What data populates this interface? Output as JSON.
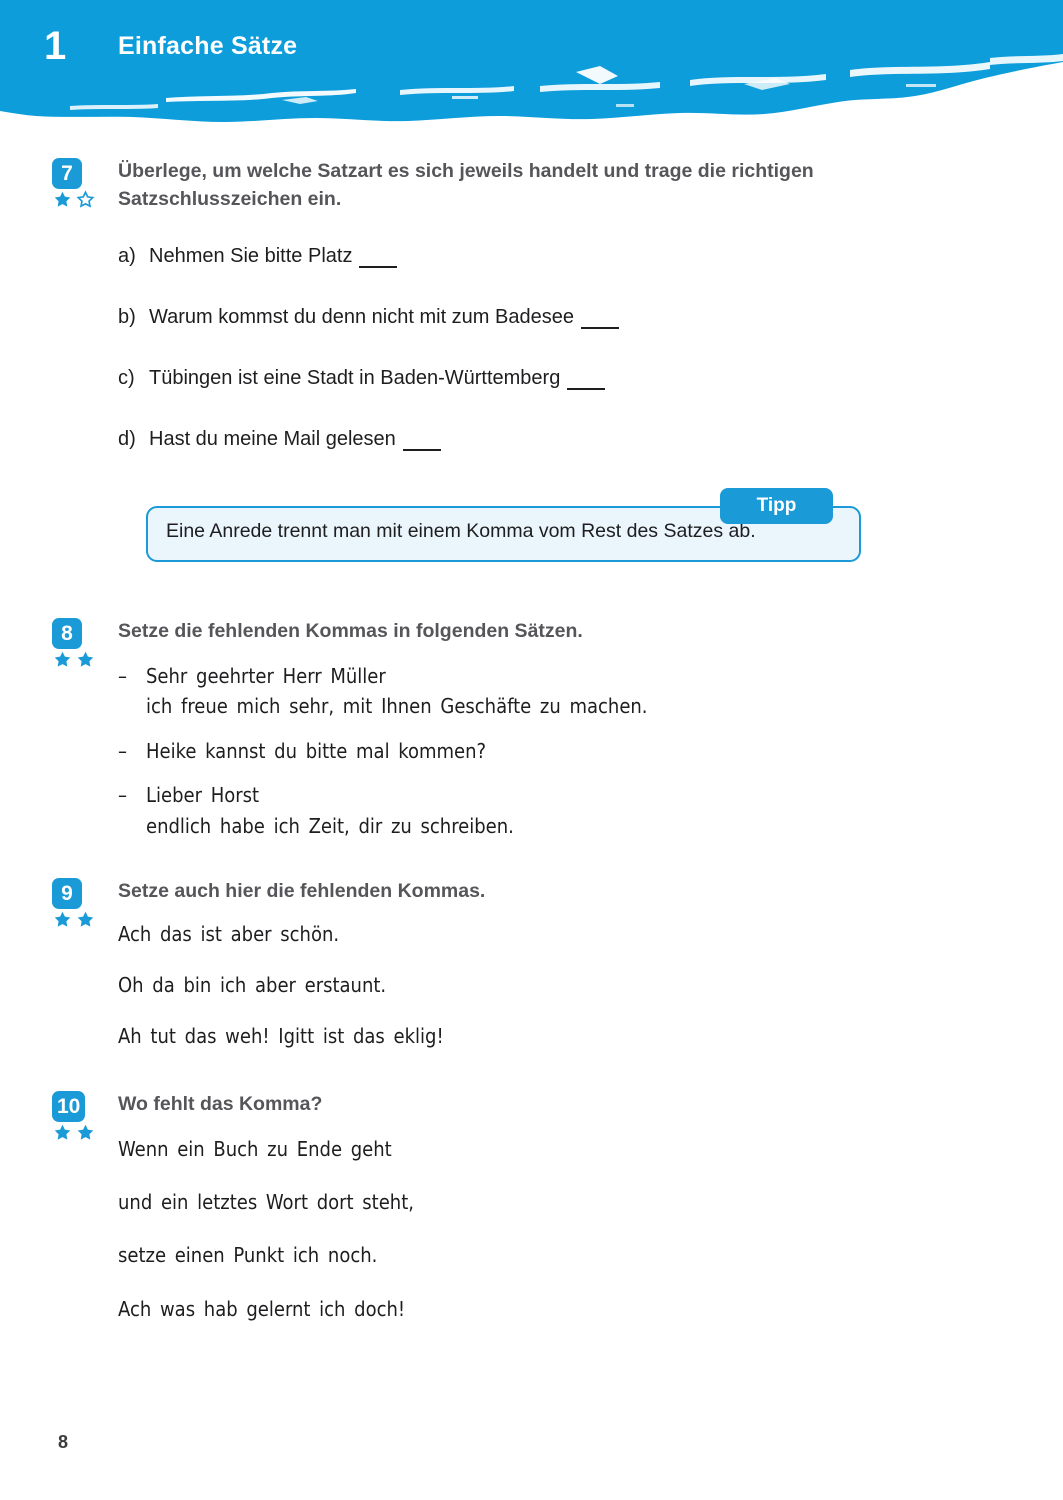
{
  "colors": {
    "brand_blue": "#0d9ddb",
    "badge_blue": "#1a9ad7",
    "tipp_fill": "#eaf5fc",
    "heading_gray": "#56565a",
    "body_black": "#1e1e20"
  },
  "header": {
    "chapter_number": "1",
    "chapter_title": "Einfache Sätze"
  },
  "exercises": [
    {
      "number": "7",
      "stars_filled": 1,
      "stars_total": 2,
      "heading": "Überlege, um welche Satzart es sich jeweils handelt und trage die richtigen Satzschlusszeichen ein.",
      "items": [
        {
          "label": "a)",
          "text": "Nehmen Sie bitte Platz"
        },
        {
          "label": "b)",
          "text": "Warum kommst du denn nicht mit zum Badesee"
        },
        {
          "label": "c)",
          "text": "Tübingen ist eine Stadt in Baden-Württemberg"
        },
        {
          "label": "d)",
          "text": "Hast du meine Mail gelesen"
        }
      ],
      "tipp": {
        "tab_label": "Tipp",
        "text": "Eine Anrede trennt man mit einem Komma vom Rest des Satzes ab."
      }
    },
    {
      "number": "8",
      "stars_filled": 2,
      "stars_total": 2,
      "heading": "Setze die fehlenden Kommas in folgenden Sätzen.",
      "bullets": [
        [
          "Sehr geehrter Herr Müller",
          "ich freue mich sehr, mit Ihnen Geschäfte zu machen."
        ],
        [
          "Heike kannst du bitte mal kommen?"
        ],
        [
          "Lieber Horst",
          "endlich habe ich Zeit, dir zu schreiben."
        ]
      ]
    },
    {
      "number": "9",
      "stars_filled": 2,
      "stars_total": 2,
      "heading": "Setze auch hier die fehlenden Kommas.",
      "lines": [
        "Ach das ist aber schön.",
        "Oh da bin ich aber erstaunt.",
        "Ah tut das weh! Igitt ist das eklig!"
      ]
    },
    {
      "number": "10",
      "stars_filled": 2,
      "stars_total": 2,
      "heading": "Wo fehlt das Komma?",
      "lines": [
        "Wenn ein Buch zu Ende geht",
        "und ein letztes Wort dort steht,",
        "setze einen Punkt ich noch.",
        "Ach was hab gelernt ich doch!"
      ]
    }
  ],
  "footer": {
    "page_number": "8"
  }
}
